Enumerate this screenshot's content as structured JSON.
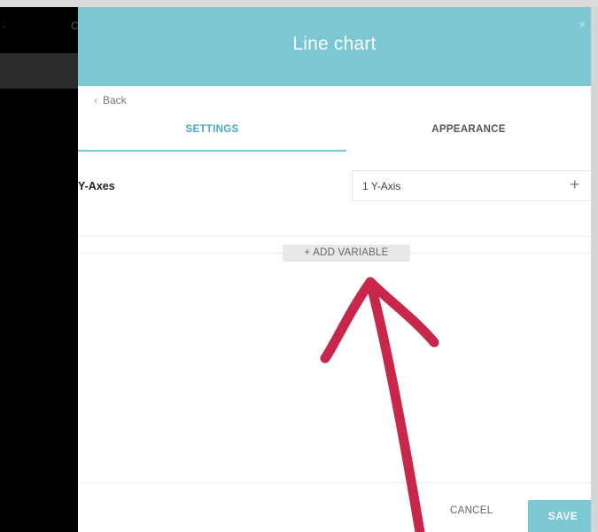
{
  "modal": {
    "title": "Line chart",
    "close_glyph": "×",
    "back_label": "Back",
    "back_glyph": "‹"
  },
  "tabs": [
    {
      "label": "SETTINGS",
      "active": true
    },
    {
      "label": "APPEARANCE",
      "active": false
    }
  ],
  "settings": {
    "y_axes_label": "Y-Axes",
    "y_axes_value": "1 Y-Axis",
    "add_glyph": "+"
  },
  "add_variable_label": "+ ADD VARIABLE",
  "footer": {
    "cancel_label": "CANCEL",
    "save_label": "SAVE"
  },
  "background": {
    "faint_glyph_left": "·",
    "faint_glyph_right": "C"
  },
  "colors": {
    "header": "#7bc7d3",
    "accent": "#4aa8bf",
    "annotation_arrow": "#c8264a"
  }
}
